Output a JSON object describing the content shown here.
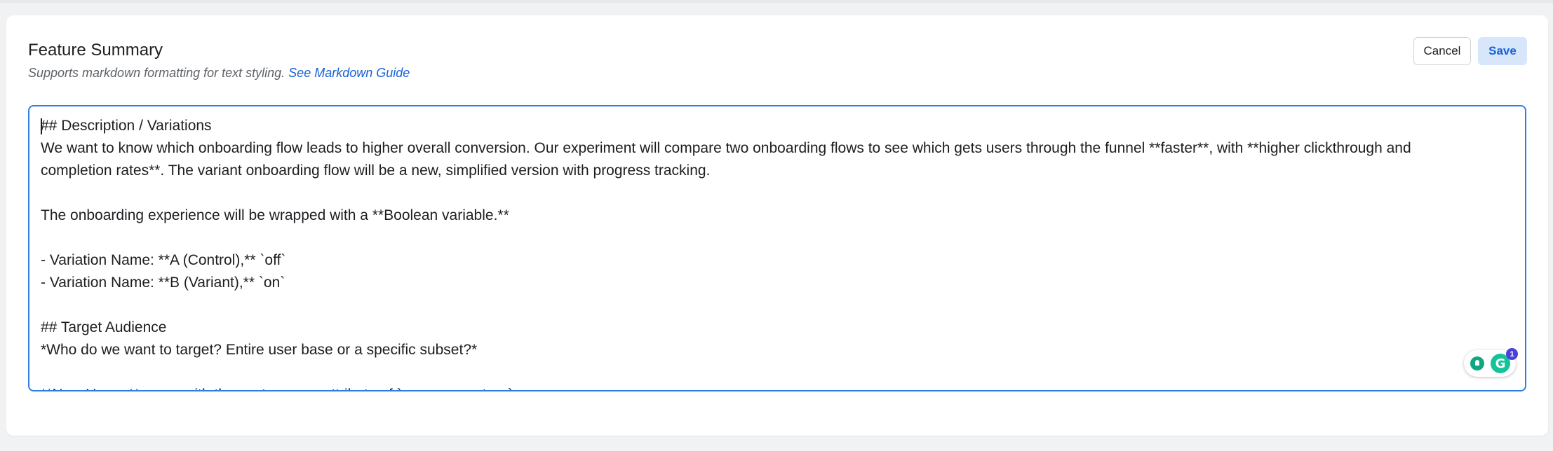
{
  "section": {
    "title": "Feature Summary",
    "subtitle_text": "Supports markdown formatting for text styling.",
    "guide_link": "See Markdown Guide"
  },
  "actions": {
    "cancel_label": "Cancel",
    "save_label": "Save"
  },
  "editor": {
    "content": "## Description / Variations\nWe want to know which onboarding flow leads to higher overall conversion. Our experiment will compare two onboarding flows to see which gets users through the funnel **faster**, with **higher clickthrough and completion rates**. The variant onboarding flow will be a new, simplified version with progress tracking.\n\nThe onboarding experience will be wrapped with a **Boolean variable.**\n\n- Variation Name: **A (Control),** `off`\n- Variation Name: **B (Variant),** `on`\n\n## Target Audience\n*Who do we want to target? Entire user base or a specific subset?*\n\n**New Users:** users with the custom user attribute of `new_user = true`"
  },
  "grammarly": {
    "logo_letter": "G",
    "badge_count": "1",
    "colors": {
      "brand": "#15c39a",
      "badge": "#4a3fd9"
    }
  },
  "colors": {
    "accent": "#2f7de1",
    "link": "#1662d6",
    "save_bg": "#d7e6fb"
  }
}
